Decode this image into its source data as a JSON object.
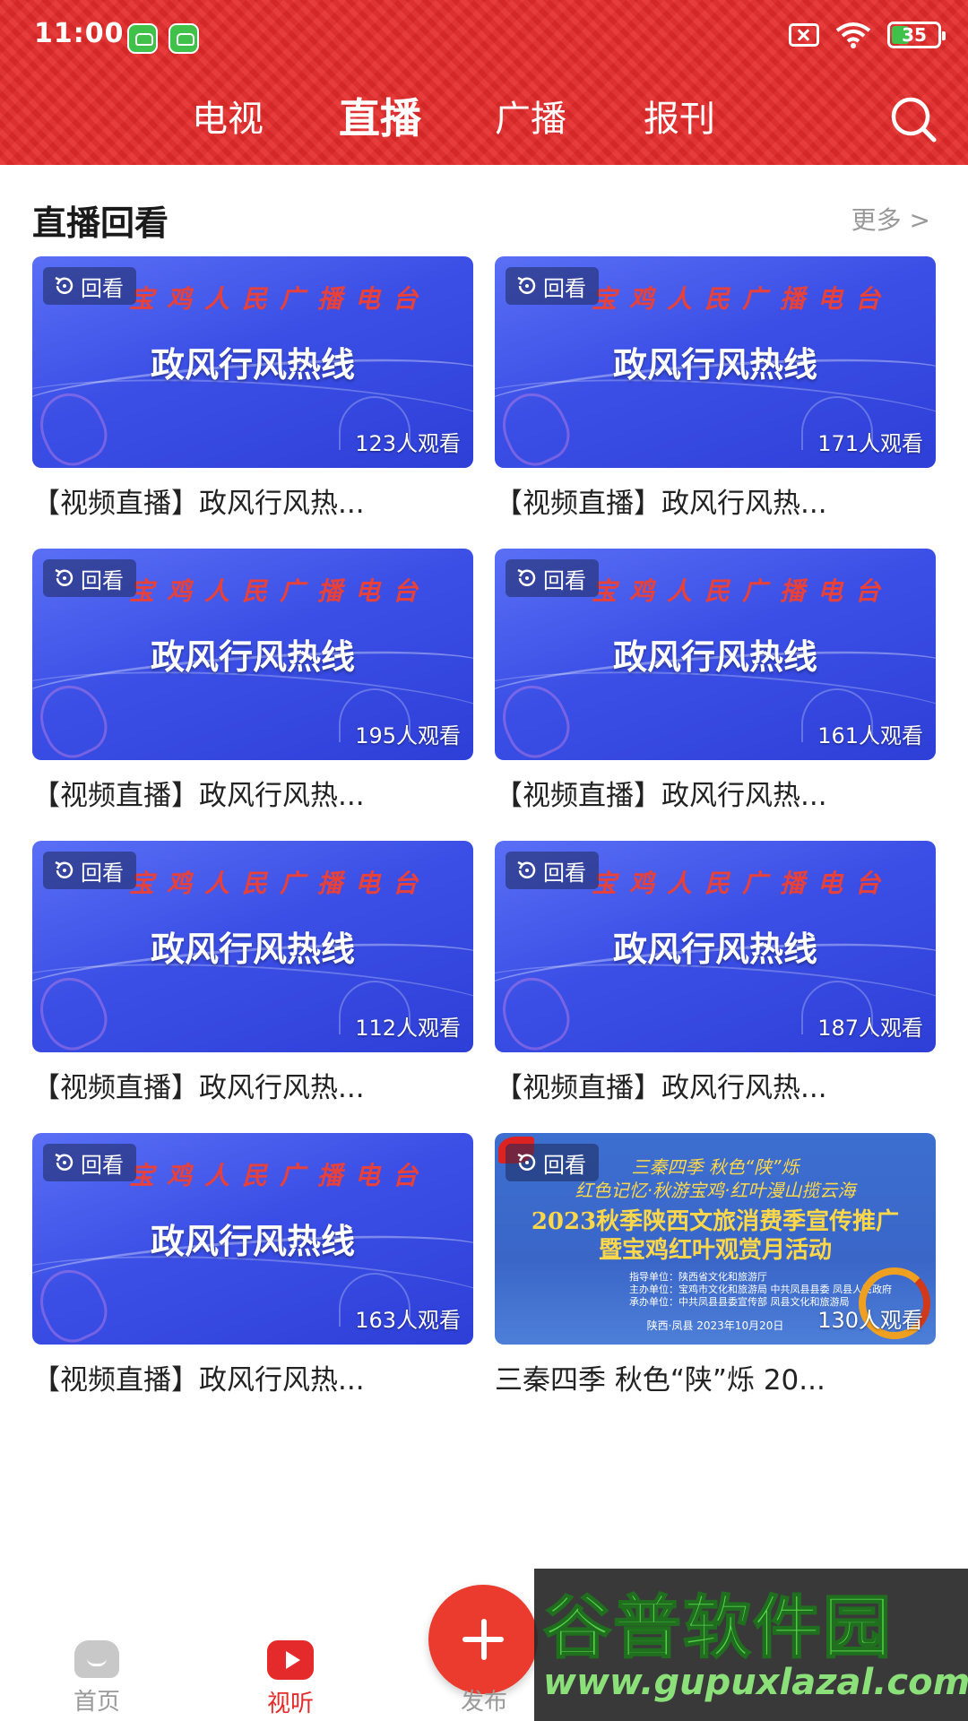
{
  "status_bar": {
    "time": "11:00",
    "battery": "35",
    "battery_level": 0.35
  },
  "top_tabs": [
    {
      "label": "电视"
    },
    {
      "label": "直播",
      "active": true
    },
    {
      "label": "广播"
    },
    {
      "label": "报刊"
    }
  ],
  "section": {
    "title": "直播回看",
    "more": "更多 >"
  },
  "cards": [
    {
      "badge": "回看",
      "station": "宝鸡人民广播电台",
      "headline": "政风行风热线",
      "views": "123人观看",
      "title": "【视频直播】政风行风热..."
    },
    {
      "badge": "回看",
      "station": "宝鸡人民广播电台",
      "headline": "政风行风热线",
      "views": "171人观看",
      "title": "【视频直播】政风行风热..."
    },
    {
      "badge": "回看",
      "station": "宝鸡人民广播电台",
      "headline": "政风行风热线",
      "views": "195人观看",
      "title": "【视频直播】政风行风热..."
    },
    {
      "badge": "回看",
      "station": "宝鸡人民广播电台",
      "headline": "政风行风热线",
      "views": "161人观看",
      "title": "【视频直播】政风行风热..."
    },
    {
      "badge": "回看",
      "station": "宝鸡人民广播电台",
      "headline": "政风行风热线",
      "views": "112人观看",
      "title": "【视频直播】政风行风热..."
    },
    {
      "badge": "回看",
      "station": "宝鸡人民广播电台",
      "headline": "政风行风热线",
      "views": "187人观看",
      "title": "【视频直播】政风行风热..."
    },
    {
      "badge": "回看",
      "station": "宝鸡人民广播电台",
      "headline": "政风行风热线",
      "views": "163人观看",
      "title": "【视频直播】政风行风热..."
    },
    {
      "badge": "回看",
      "views": "130人观看",
      "title": "三秦四季 秋色“陕”烁 20...",
      "poster": {
        "line1": "三秦四季  秋色“陕”烁",
        "line2": "红色记忆·秋游宝鸡·红叶漫山揽云海",
        "line3": "2023秋季陕西文旅消费季宣传推广",
        "line4": "暨宝鸡红叶观赏月活动",
        "credits": [
          "指导单位：陕西省文化和旅游厅",
          "主办单位：宝鸡市文化和旅游局 中共凤县县委 凤县人民政府",
          "承办单位：中共凤县县委宣传部 凤县文化和旅游局"
        ],
        "date": "陕西·凤县   2023年10月20日"
      }
    }
  ],
  "bottom_nav": [
    {
      "label": "首页",
      "icon": "home-icon"
    },
    {
      "label": "视听",
      "icon": "play-icon",
      "active": true
    },
    {
      "label": "发布",
      "icon": "plus-icon"
    }
  ],
  "watermark": {
    "text": "谷普软件园",
    "url": "www.gupuxlazal.com"
  },
  "colors": {
    "brand_red": "#e42a2a",
    "thumb_blue": "#3b4fe6",
    "muted": "#999999"
  }
}
